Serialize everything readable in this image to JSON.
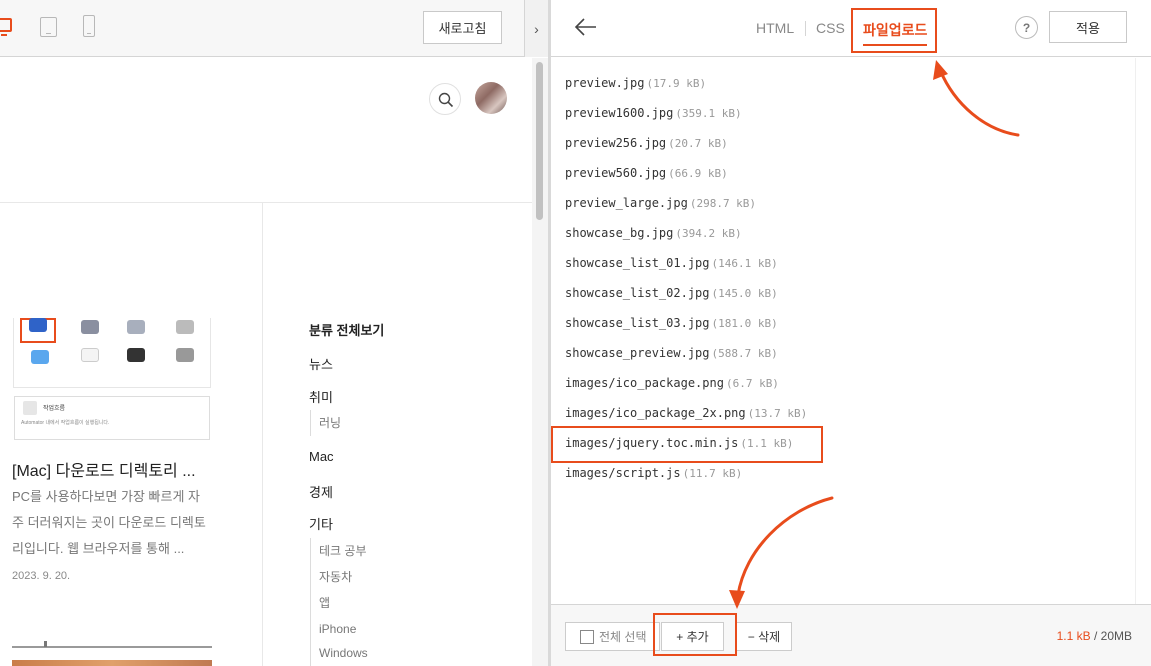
{
  "toolbar": {
    "devices": [
      "desktop-icon",
      "tablet-icon",
      "mobile-icon"
    ],
    "refresh_label": "새로고침",
    "collapse_icon": "chevron-right-icon"
  },
  "preview": {
    "post": {
      "thumb_card_title": "작업흐름",
      "thumb_card_sub": "Automator 내에서 작업흐름이 실행됩니다.",
      "title": "[Mac] 다운로드 디렉토리 ...",
      "excerpt": "PC를 사용하다보면 가장 빠르게 자주 더러워지는 곳이 다운로드 디렉토리입니다. 웹 브라우저를 통해 ...",
      "date": "2023. 9. 20."
    },
    "categories": {
      "all": "분류 전체보기",
      "news": "뉴스",
      "hobby": "취미",
      "hobby_sub": [
        "러닝"
      ],
      "mac": "Mac",
      "economy": "경제",
      "etc": "기타",
      "etc_sub": [
        "테크 공부",
        "자동차",
        "앱",
        "iPhone",
        "Windows"
      ]
    }
  },
  "editor": {
    "tabs": [
      "HTML",
      "CSS",
      "파일업로드"
    ],
    "active_tab": "파일업로드",
    "help_label": "?",
    "apply_label": "적용",
    "files": [
      {
        "name": "preview.jpg",
        "size": "(17.9 kB)"
      },
      {
        "name": "preview1600.jpg",
        "size": "(359.1 kB)"
      },
      {
        "name": "preview256.jpg",
        "size": "(20.7 kB)"
      },
      {
        "name": "preview560.jpg",
        "size": "(66.9 kB)"
      },
      {
        "name": "preview_large.jpg",
        "size": "(298.7 kB)"
      },
      {
        "name": "showcase_bg.jpg",
        "size": "(394.2 kB)"
      },
      {
        "name": "showcase_list_01.jpg",
        "size": "(146.1 kB)"
      },
      {
        "name": "showcase_list_02.jpg",
        "size": "(145.0 kB)"
      },
      {
        "name": "showcase_list_03.jpg",
        "size": "(181.0 kB)"
      },
      {
        "name": "showcase_preview.jpg",
        "size": "(588.7 kB)"
      },
      {
        "name": "images/ico_package.png",
        "size": "(6.7 kB)"
      },
      {
        "name": "images/ico_package_2x.png",
        "size": "(13.7 kB)"
      },
      {
        "name": "images/jquery.toc.min.js",
        "size": "(1.1 kB)"
      },
      {
        "name": "images/script.js",
        "size": "(11.7 kB)"
      }
    ],
    "footer": {
      "select_all": "전체 선택",
      "add": "+ 추가",
      "delete": "− 삭제",
      "quota_used": "1.1 kB",
      "quota_total": " / 20MB"
    }
  },
  "colors": {
    "accent": "#e84c1c",
    "annotation": "#e84c1c"
  }
}
